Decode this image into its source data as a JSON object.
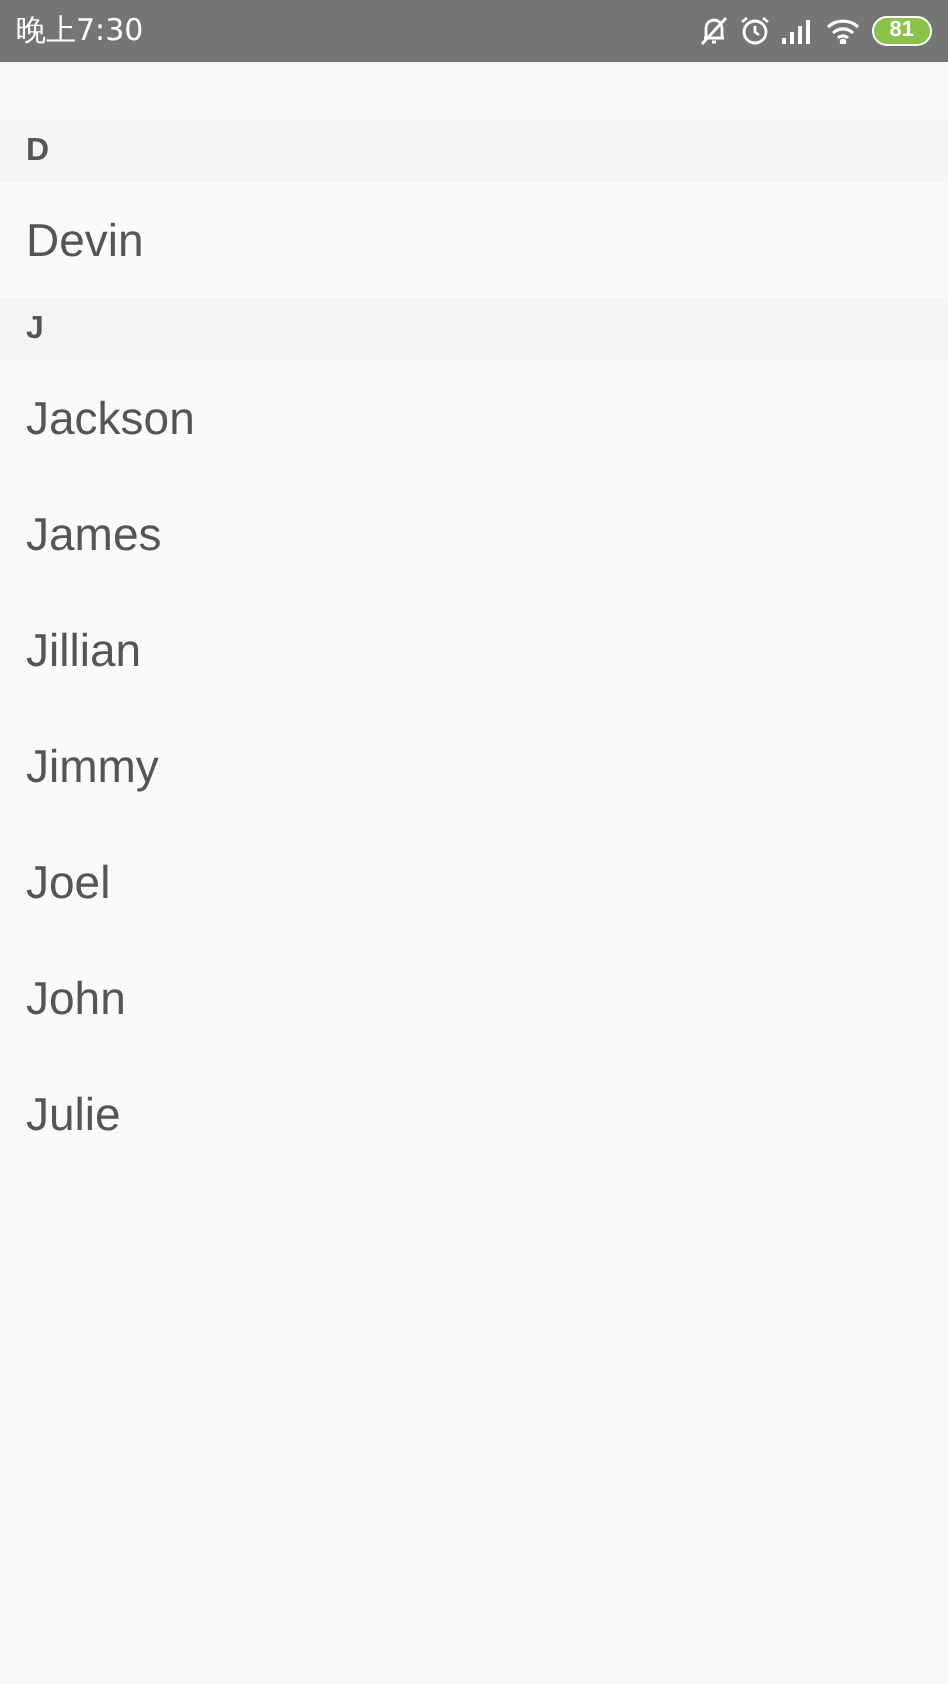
{
  "status_bar": {
    "time": "晚上7:30",
    "battery": "81"
  },
  "sections": [
    {
      "letter": "D",
      "names": [
        "Devin"
      ]
    },
    {
      "letter": "J",
      "names": [
        "Jackson",
        "James",
        "Jillian",
        "Jimmy",
        "Joel",
        "John",
        "Julie"
      ]
    }
  ]
}
